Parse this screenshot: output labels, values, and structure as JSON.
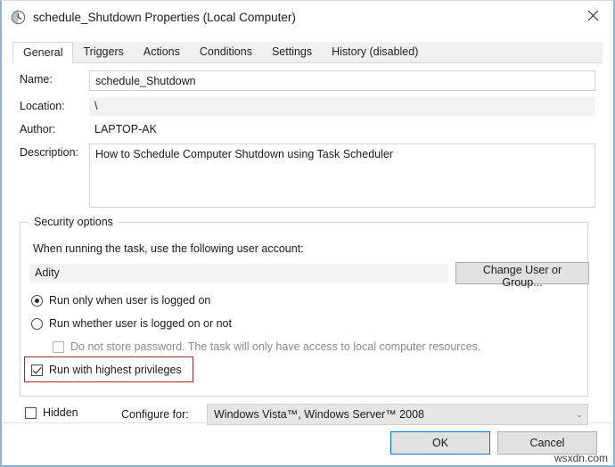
{
  "window": {
    "title": "schedule_Shutdown Properties (Local Computer)",
    "icon": "task-scheduler-clock-icon",
    "close_label": "×",
    "accent_border": "#8ab4d8"
  },
  "tabs": [
    {
      "label": "General",
      "active": true
    },
    {
      "label": "Triggers",
      "active": false
    },
    {
      "label": "Actions",
      "active": false
    },
    {
      "label": "Conditions",
      "active": false
    },
    {
      "label": "Settings",
      "active": false
    },
    {
      "label": "History (disabled)",
      "active": false
    }
  ],
  "general": {
    "name_label": "Name:",
    "name_value": "schedule_Shutdown",
    "name_placeholder": "",
    "location_label": "Location:",
    "location_value": "\\",
    "author_label": "Author:",
    "author_value": "LAPTOP-AK",
    "description_label": "Description:",
    "description_value": "How to Schedule Computer Shutdown using Task Scheduler",
    "description_placeholder": ""
  },
  "security": {
    "legend": "Security options",
    "account_prompt": "When running the task, use the following user account:",
    "account_value": "Adity",
    "change_user_button": "Change User or Group...",
    "radio_logged_on": "Run only when user is logged on",
    "radio_logged_on_checked": true,
    "radio_whether": "Run whether user is logged on or not",
    "radio_whether_checked": false,
    "checkbox_no_store_password": "Do not store password.  The task will only have access to local computer resources.",
    "checkbox_no_store_password_checked": false,
    "checkbox_no_store_password_disabled": true,
    "checkbox_highest_privileges": "Run with highest privileges",
    "checkbox_highest_privileges_checked": true,
    "highlight_color": "#9e2c2c"
  },
  "footer": {
    "hidden_label": "Hidden",
    "hidden_checked": false,
    "configure_for_label": "Configure for:",
    "configure_for_value": "Windows Vista™, Windows Server™ 2008",
    "chevron": "⌄",
    "ok_button": "OK",
    "cancel_button": "Cancel"
  },
  "watermark": "wsxdn.com"
}
